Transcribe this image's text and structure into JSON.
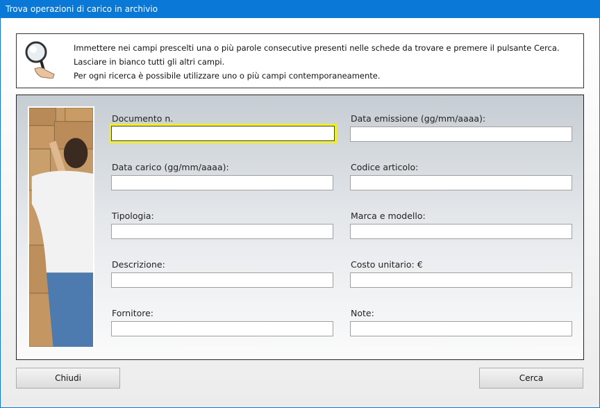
{
  "window": {
    "title": "Trova operazioni di carico in archivio"
  },
  "info": {
    "icon": "magnifier-hand-icon",
    "line1": "Immettere nei campi prescelti una o più parole consecutive presenti nelle schede da trovare e premere il pulsante Cerca.",
    "line2": "Lasciare in bianco tutti gli altri campi.",
    "line3": "Per ogni ricerca è possibile utilizzare uno o più campi contemporaneamente."
  },
  "fields": {
    "documento": {
      "label": "Documento n.",
      "value": ""
    },
    "data_emissione": {
      "label": "Data emissione (gg/mm/aaaa):",
      "value": ""
    },
    "data_carico": {
      "label": "Data carico (gg/mm/aaaa):",
      "value": ""
    },
    "codice_articolo": {
      "label": "Codice articolo:",
      "value": ""
    },
    "tipologia": {
      "label": "Tipologia:",
      "value": ""
    },
    "marca_modello": {
      "label": "Marca e modello:",
      "value": ""
    },
    "descrizione": {
      "label": "Descrizione:",
      "value": ""
    },
    "costo_unitario": {
      "label": "Costo unitario: €",
      "value": ""
    },
    "fornitore": {
      "label": "Fornitore:",
      "value": ""
    },
    "note": {
      "label": "Note:",
      "value": ""
    }
  },
  "buttons": {
    "close": "Chiudi",
    "search": "Cerca"
  },
  "colors": {
    "titlebar": "#0a78d7",
    "active_field_border": "#f0f01e"
  }
}
